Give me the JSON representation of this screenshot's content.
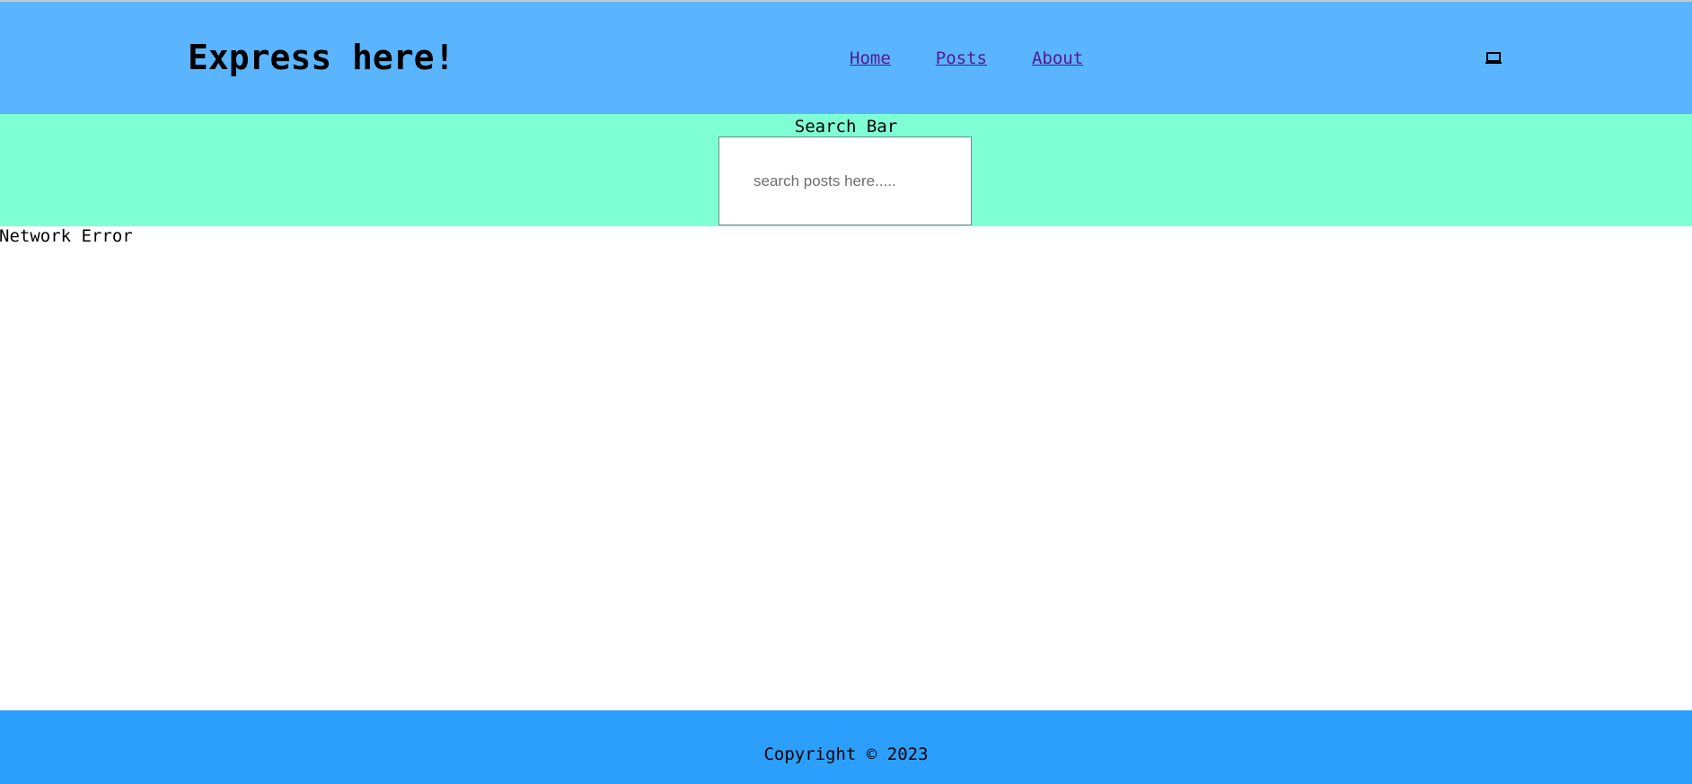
{
  "header": {
    "title": "Express here!",
    "nav": [
      {
        "label": "Home"
      },
      {
        "label": "Posts"
      },
      {
        "label": "About"
      }
    ],
    "icon": "laptop-icon"
  },
  "search": {
    "label": "Search Bar",
    "placeholder": "search posts here.....",
    "value": ""
  },
  "main": {
    "error_message": "Network Error"
  },
  "footer": {
    "copyright": "Copyright © 2023"
  },
  "colors": {
    "header_bg": "#5ab4fe",
    "search_bg": "#7fffd4",
    "footer_bg": "#2b9ffb",
    "link": "#551a8b"
  }
}
